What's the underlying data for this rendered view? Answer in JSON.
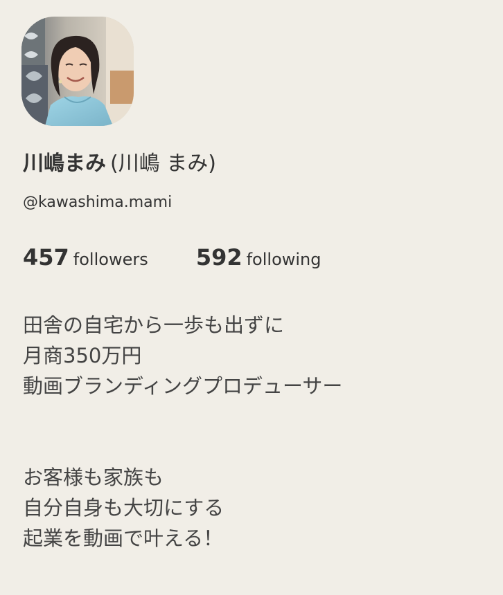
{
  "profile": {
    "display_name": "川嶋まみ",
    "full_name": "(川嶋 まみ)",
    "handle": "@kawashima.mami",
    "followers": {
      "count": "457",
      "label": "followers"
    },
    "following": {
      "count": "592",
      "label": "following"
    }
  },
  "bio": {
    "lines": [
      "田舎の自宅から一歩も出ずに",
      "月商350万円",
      "動画ブランディングプロデューサー",
      "",
      "",
      "お客様も家族も",
      "自分自身も大切にする",
      "起業を動画で叶える！"
    ]
  },
  "colors": {
    "background": "#f1eee7",
    "text": "#333333"
  }
}
